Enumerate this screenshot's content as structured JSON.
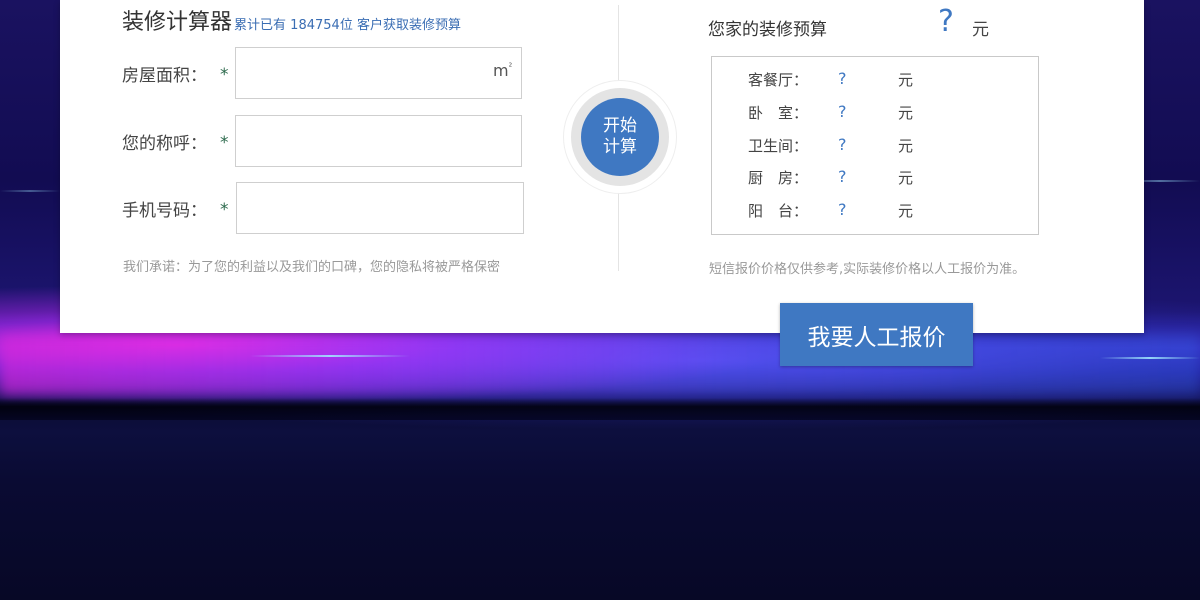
{
  "calculator": {
    "title": "装修计算器",
    "subtitle_prefix": "累计已有",
    "customer_count": "184754",
    "subtitle_suffix": "位 客户获取装修预算"
  },
  "form": {
    "area_label": "房屋面积：",
    "name_label": "您的称呼：",
    "phone_label": "手机号码：",
    "required_mark": "*",
    "area_value": "",
    "name_value": "",
    "phone_value": "",
    "area_unit": "m",
    "area_unit_sup": "²",
    "promise": "我们承诺：为了您的利益以及我们的口碑，您的隐私将被严格保密"
  },
  "calc_button": {
    "line1": "开始",
    "line2": "计算"
  },
  "budget": {
    "title": "您家的装修预算",
    "total": "?",
    "unit": "元",
    "rooms": [
      {
        "label": "客餐厅：",
        "value": "?",
        "unit": "元"
      },
      {
        "label": "卧　室：",
        "value": "?",
        "unit": "元"
      },
      {
        "label": "卫生间：",
        "value": "?",
        "unit": "元"
      },
      {
        "label": "厨　房：",
        "value": "?",
        "unit": "元"
      },
      {
        "label": "阳　台：",
        "value": "?",
        "unit": "元"
      }
    ],
    "note": "短信报价价格仅供参考,实际装修价格以人工报价为准。"
  },
  "quote_button": {
    "label": "我要人工报价"
  },
  "colors": {
    "accent": "#3f78c2",
    "required": "#2d6a4d"
  }
}
